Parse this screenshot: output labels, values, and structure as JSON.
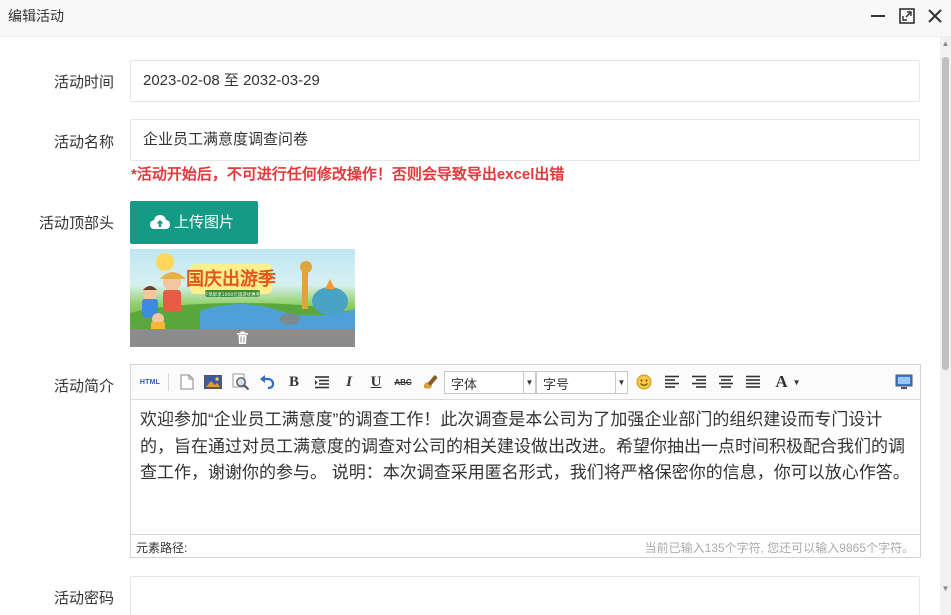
{
  "window": {
    "title": "编辑活动"
  },
  "form": {
    "time": {
      "label": "活动时间",
      "value": "2023-02-08 至 2032-03-29"
    },
    "name": {
      "label": "活动名称",
      "value": "企业员工满意度调查问卷"
    },
    "warning": "*活动开始后，不可进行任何修改操作！否则会导致导出excel出错",
    "header": {
      "label": "活动顶部头",
      "upload_label": "上传图片",
      "banner_title": "国庆出游季",
      "banner_sub": "下单即享1000元旅游优惠券"
    },
    "intro": {
      "label": "活动简介",
      "toolbar": {
        "html_label": "HTML",
        "bold": "B",
        "italic": "I",
        "underline": "U",
        "strike": "ABC",
        "font_family": "字体",
        "font_size": "字号",
        "font_color": "A"
      },
      "content": "欢迎参加“企业员工满意度”的调查工作！此次调查是本公司为了加强企业部门的组织建设而专门设计的，旨在通过对员工满意度的调查对公司的相关建设做出改进。希望你抽出一点时间积极配合我们的调查工作，谢谢你的参与。 说明：本次调查采用匿名形式，我们将严格保密你的信息，你可以放心作答。",
      "path_label": "元素路径:",
      "count_label": "当前已输入135个字符, 您还可以输入9865个字符。"
    },
    "password": {
      "label": "活动密码",
      "value": ""
    }
  },
  "colors": {
    "primary": "#159a86",
    "warning": "#e4393c"
  }
}
